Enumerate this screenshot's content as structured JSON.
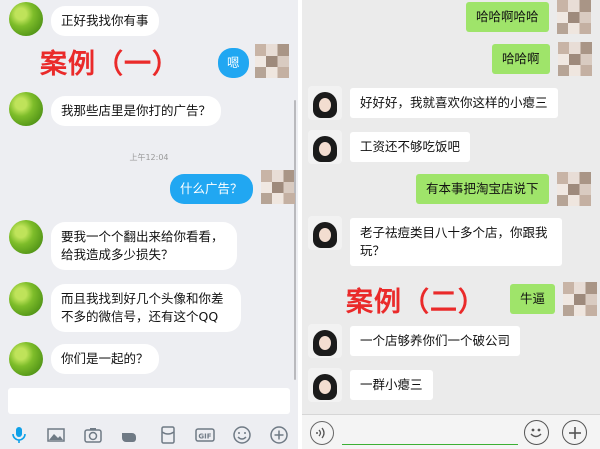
{
  "left_chat": {
    "case_label": "案例（一）",
    "timestamp": "上午12:04",
    "messages": [
      {
        "side": "left",
        "text": "正好我找你有事"
      },
      {
        "side": "right",
        "text": "嗯"
      },
      {
        "side": "left",
        "text": "我那些店里是你打的广告？"
      },
      {
        "side": "right",
        "text": "什么广告？"
      },
      {
        "side": "left",
        "text": "要我一个个翻出来给你看看，给我造成多少损失？"
      },
      {
        "side": "left",
        "text": "而且我找到好几个头像和你差不多的微信号，还有这个QQ"
      },
      {
        "side": "left",
        "text": "你们是一起的？"
      }
    ],
    "toolbar_icons": [
      "microphone-icon",
      "image-icon",
      "camera-icon",
      "hand-icon",
      "red-packet-icon",
      "gif-icon",
      "emoji-icon",
      "plus-icon"
    ]
  },
  "right_chat": {
    "case_label": "案例（二）",
    "messages": [
      {
        "side": "right",
        "text": "哈哈啊哈哈"
      },
      {
        "side": "right",
        "text": "哈哈啊"
      },
      {
        "side": "left",
        "text": "好好好，我就喜欢你这样的小瘪三"
      },
      {
        "side": "left",
        "text": "工资还不够吃饭吧"
      },
      {
        "side": "right",
        "text": "有本事把淘宝店说下"
      },
      {
        "side": "left",
        "text": "老子祛痘类目八十多个店，你跟我玩？"
      },
      {
        "side": "right",
        "text": "牛逼"
      },
      {
        "side": "left",
        "text": "一个店够养你们一个破公司"
      },
      {
        "side": "left",
        "text": "一群小瘪三"
      }
    ]
  },
  "colors": {
    "qq_blue": "#21a7f2",
    "wechat_green": "#9fe46a",
    "case_red": "#ea2a2a"
  }
}
